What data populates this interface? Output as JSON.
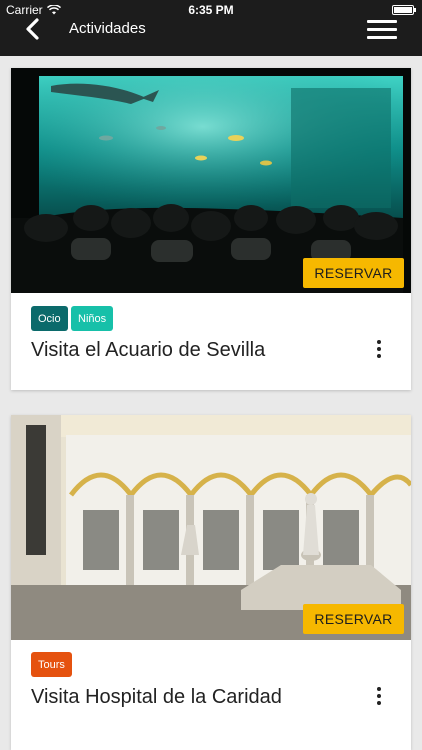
{
  "status_bar": {
    "carrier": "Carrier",
    "time": "6:35 PM"
  },
  "header": {
    "title": "Actividades",
    "back_icon": "chevron-left-icon",
    "menu_icon": "hamburger-menu-icon"
  },
  "activities": [
    {
      "title": "Visita el Acuario de Sevilla",
      "button": "RESERVAR",
      "tags": [
        {
          "label": "Ocio",
          "color": "#0b6a6b"
        },
        {
          "label": "Niños",
          "color": "#17c0a9"
        }
      ]
    },
    {
      "title": "Visita Hospital de la Caridad",
      "button": "RESERVAR",
      "tags": [
        {
          "label": "Tours",
          "color": "#e5520f"
        }
      ]
    }
  ],
  "colors": {
    "header_bg": "#1c1c1c",
    "reserve_button": "#f6b800",
    "page_bg": "#e9e9e9"
  }
}
